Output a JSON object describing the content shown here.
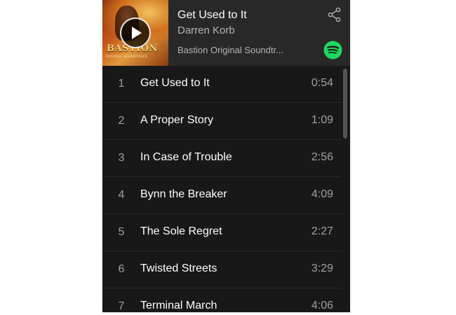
{
  "header": {
    "track_title": "Get Used to It",
    "artist": "Darren Korb",
    "album": "Bastion Original Soundtrack",
    "album_display": "Bastion Original Soundtr...",
    "cover_text": "BASTION",
    "cover_subtext": "ORIGINAL SOUNDTRACK",
    "play_icon": "play-icon",
    "share_icon": "share-icon",
    "brand_icon": "spotify-logo"
  },
  "colors": {
    "background": "#181818",
    "header_background": "#282828",
    "primary_text": "#ffffff",
    "secondary_text": "#b3b3b3",
    "brand": "#1ed760"
  },
  "tracks": [
    {
      "number": "1",
      "title": "Get Used to It",
      "duration": "0:54"
    },
    {
      "number": "2",
      "title": "A Proper Story",
      "duration": "1:09"
    },
    {
      "number": "3",
      "title": "In Case of Trouble",
      "duration": "2:56"
    },
    {
      "number": "4",
      "title": "Bynn the Breaker",
      "duration": "4:09"
    },
    {
      "number": "5",
      "title": "The Sole Regret",
      "duration": "2:27"
    },
    {
      "number": "6",
      "title": "Twisted Streets",
      "duration": "3:29"
    },
    {
      "number": "7",
      "title": "Terminal March",
      "duration": "4:06"
    }
  ]
}
